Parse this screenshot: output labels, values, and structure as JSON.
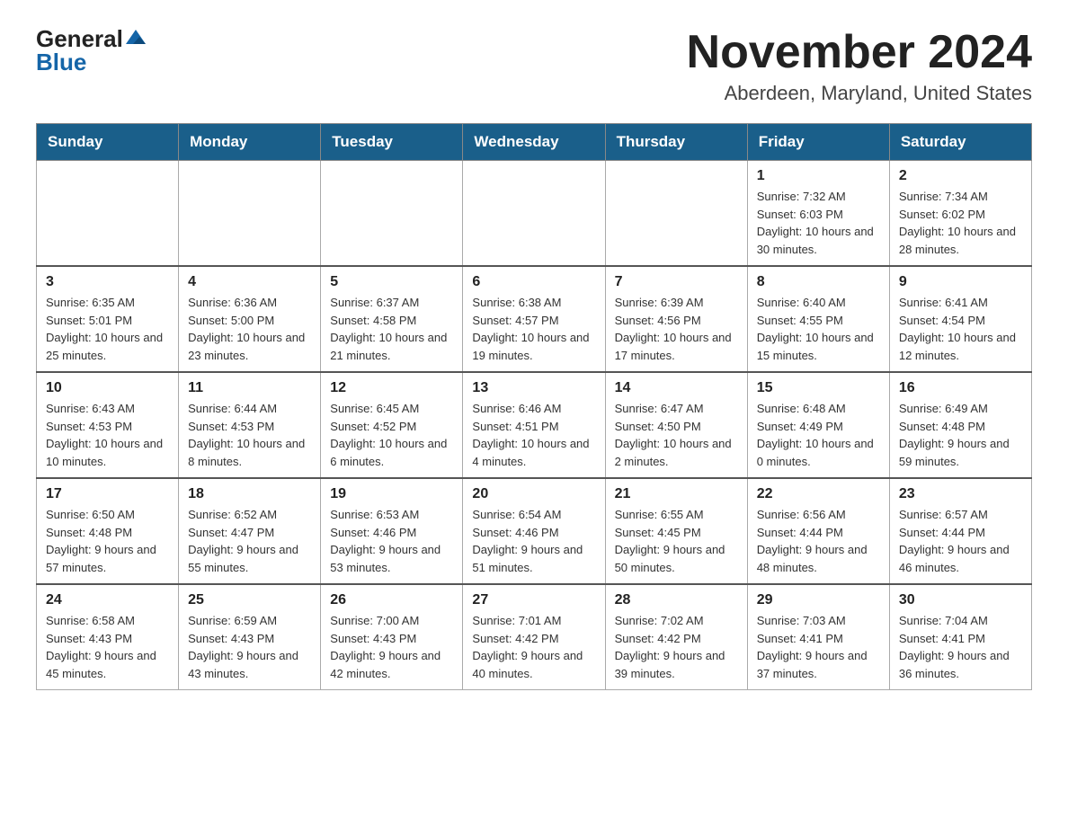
{
  "header": {
    "logo_general": "General",
    "logo_blue": "Blue",
    "month_title": "November 2024",
    "location": "Aberdeen, Maryland, United States"
  },
  "weekdays": [
    "Sunday",
    "Monday",
    "Tuesday",
    "Wednesday",
    "Thursday",
    "Friday",
    "Saturday"
  ],
  "weeks": [
    [
      {
        "day": "",
        "info": ""
      },
      {
        "day": "",
        "info": ""
      },
      {
        "day": "",
        "info": ""
      },
      {
        "day": "",
        "info": ""
      },
      {
        "day": "",
        "info": ""
      },
      {
        "day": "1",
        "info": "Sunrise: 7:32 AM\nSunset: 6:03 PM\nDaylight: 10 hours and 30 minutes."
      },
      {
        "day": "2",
        "info": "Sunrise: 7:34 AM\nSunset: 6:02 PM\nDaylight: 10 hours and 28 minutes."
      }
    ],
    [
      {
        "day": "3",
        "info": "Sunrise: 6:35 AM\nSunset: 5:01 PM\nDaylight: 10 hours and 25 minutes."
      },
      {
        "day": "4",
        "info": "Sunrise: 6:36 AM\nSunset: 5:00 PM\nDaylight: 10 hours and 23 minutes."
      },
      {
        "day": "5",
        "info": "Sunrise: 6:37 AM\nSunset: 4:58 PM\nDaylight: 10 hours and 21 minutes."
      },
      {
        "day": "6",
        "info": "Sunrise: 6:38 AM\nSunset: 4:57 PM\nDaylight: 10 hours and 19 minutes."
      },
      {
        "day": "7",
        "info": "Sunrise: 6:39 AM\nSunset: 4:56 PM\nDaylight: 10 hours and 17 minutes."
      },
      {
        "day": "8",
        "info": "Sunrise: 6:40 AM\nSunset: 4:55 PM\nDaylight: 10 hours and 15 minutes."
      },
      {
        "day": "9",
        "info": "Sunrise: 6:41 AM\nSunset: 4:54 PM\nDaylight: 10 hours and 12 minutes."
      }
    ],
    [
      {
        "day": "10",
        "info": "Sunrise: 6:43 AM\nSunset: 4:53 PM\nDaylight: 10 hours and 10 minutes."
      },
      {
        "day": "11",
        "info": "Sunrise: 6:44 AM\nSunset: 4:53 PM\nDaylight: 10 hours and 8 minutes."
      },
      {
        "day": "12",
        "info": "Sunrise: 6:45 AM\nSunset: 4:52 PM\nDaylight: 10 hours and 6 minutes."
      },
      {
        "day": "13",
        "info": "Sunrise: 6:46 AM\nSunset: 4:51 PM\nDaylight: 10 hours and 4 minutes."
      },
      {
        "day": "14",
        "info": "Sunrise: 6:47 AM\nSunset: 4:50 PM\nDaylight: 10 hours and 2 minutes."
      },
      {
        "day": "15",
        "info": "Sunrise: 6:48 AM\nSunset: 4:49 PM\nDaylight: 10 hours and 0 minutes."
      },
      {
        "day": "16",
        "info": "Sunrise: 6:49 AM\nSunset: 4:48 PM\nDaylight: 9 hours and 59 minutes."
      }
    ],
    [
      {
        "day": "17",
        "info": "Sunrise: 6:50 AM\nSunset: 4:48 PM\nDaylight: 9 hours and 57 minutes."
      },
      {
        "day": "18",
        "info": "Sunrise: 6:52 AM\nSunset: 4:47 PM\nDaylight: 9 hours and 55 minutes."
      },
      {
        "day": "19",
        "info": "Sunrise: 6:53 AM\nSunset: 4:46 PM\nDaylight: 9 hours and 53 minutes."
      },
      {
        "day": "20",
        "info": "Sunrise: 6:54 AM\nSunset: 4:46 PM\nDaylight: 9 hours and 51 minutes."
      },
      {
        "day": "21",
        "info": "Sunrise: 6:55 AM\nSunset: 4:45 PM\nDaylight: 9 hours and 50 minutes."
      },
      {
        "day": "22",
        "info": "Sunrise: 6:56 AM\nSunset: 4:44 PM\nDaylight: 9 hours and 48 minutes."
      },
      {
        "day": "23",
        "info": "Sunrise: 6:57 AM\nSunset: 4:44 PM\nDaylight: 9 hours and 46 minutes."
      }
    ],
    [
      {
        "day": "24",
        "info": "Sunrise: 6:58 AM\nSunset: 4:43 PM\nDaylight: 9 hours and 45 minutes."
      },
      {
        "day": "25",
        "info": "Sunrise: 6:59 AM\nSunset: 4:43 PM\nDaylight: 9 hours and 43 minutes."
      },
      {
        "day": "26",
        "info": "Sunrise: 7:00 AM\nSunset: 4:43 PM\nDaylight: 9 hours and 42 minutes."
      },
      {
        "day": "27",
        "info": "Sunrise: 7:01 AM\nSunset: 4:42 PM\nDaylight: 9 hours and 40 minutes."
      },
      {
        "day": "28",
        "info": "Sunrise: 7:02 AM\nSunset: 4:42 PM\nDaylight: 9 hours and 39 minutes."
      },
      {
        "day": "29",
        "info": "Sunrise: 7:03 AM\nSunset: 4:41 PM\nDaylight: 9 hours and 37 minutes."
      },
      {
        "day": "30",
        "info": "Sunrise: 7:04 AM\nSunset: 4:41 PM\nDaylight: 9 hours and 36 minutes."
      }
    ]
  ]
}
